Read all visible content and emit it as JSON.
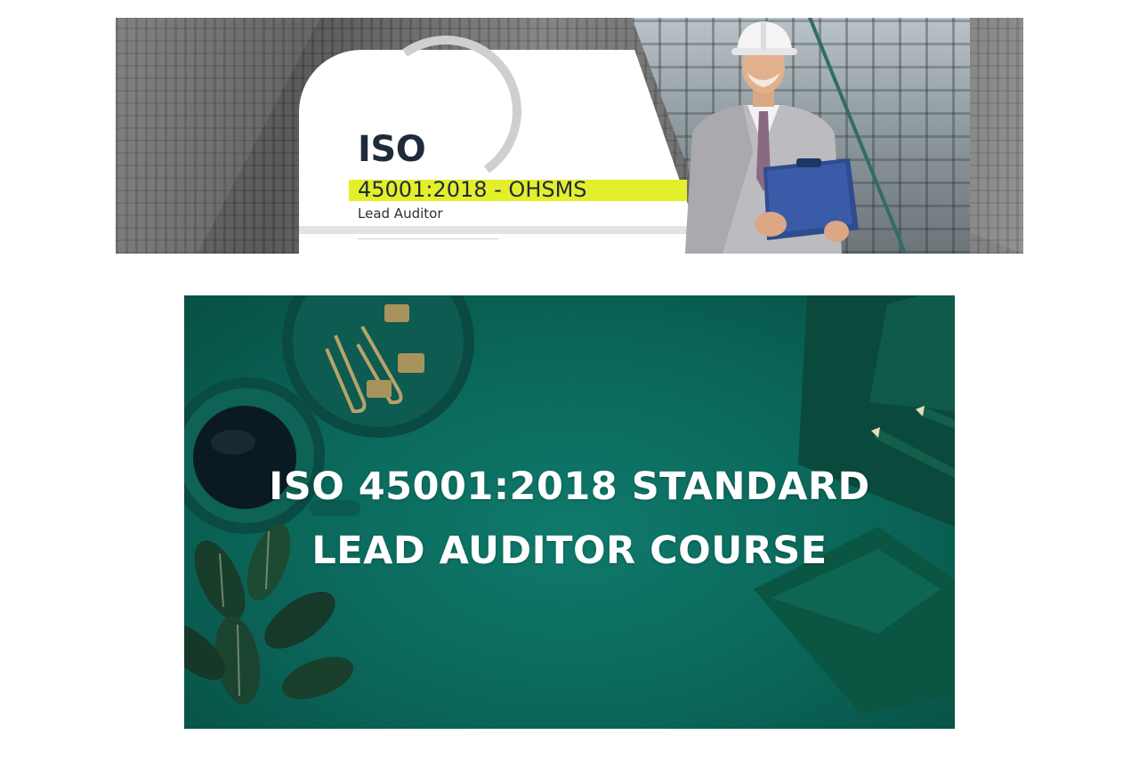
{
  "top_banner": {
    "title": "ISO",
    "subtitle": "45001:2018 - OHSMS",
    "role": "Lead Auditor",
    "accent_color": "#e4ef2c",
    "text_color": "#1f2b3a"
  },
  "bottom_banner": {
    "line1": "ISO 45001:2018 STANDARD",
    "line2": "LEAD AUDITOR COURSE",
    "background_color": "#0b6a5d"
  }
}
